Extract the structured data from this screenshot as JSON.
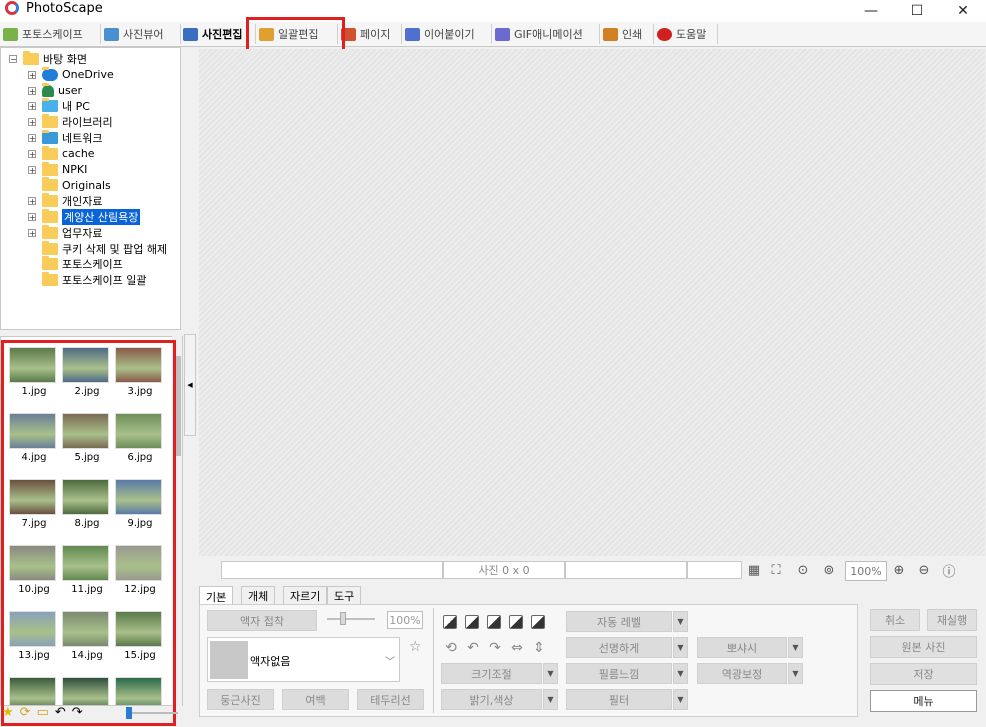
{
  "window": {
    "title": "PhotoScape",
    "minimize": "—",
    "maximize": "☐",
    "close": "✕"
  },
  "tabs": [
    {
      "label": "포토스케이프",
      "color": "#7ab24a"
    },
    {
      "label": "사진뷰어",
      "color": "#4a8fcf"
    },
    {
      "label": "사진편집",
      "color": "#3a6fbf"
    },
    {
      "label": "일괄편집",
      "color": "#e0a030"
    },
    {
      "label": "페이지",
      "color": "#d05030"
    },
    {
      "label": "이어붙이기",
      "color": "#5070d0"
    },
    {
      "label": "GIF애니메이션",
      "color": "#6a6acf"
    },
    {
      "label": "인쇄",
      "color": "#d08020"
    },
    {
      "label": "도움말",
      "color": "#d02020"
    }
  ],
  "tree": [
    {
      "label": "바탕 화면",
      "expand": "−",
      "icon": "folder-icon"
    },
    {
      "label": "OneDrive",
      "expand": "+",
      "icon": "cloud-icon"
    },
    {
      "label": "user",
      "expand": "+",
      "icon": "user-icon"
    },
    {
      "label": "내 PC",
      "expand": "+",
      "icon": "pc-icon"
    },
    {
      "label": "라이브러리",
      "expand": "+",
      "icon": "folder-icon"
    },
    {
      "label": "네트워크",
      "expand": "+",
      "icon": "network-icon"
    },
    {
      "label": "cache",
      "expand": "+",
      "icon": "folder-icon"
    },
    {
      "label": "NPKI",
      "expand": "+",
      "icon": "folder-icon"
    },
    {
      "label": "Originals",
      "expand": "",
      "icon": "folder-icon"
    },
    {
      "label": "개인자료",
      "expand": "+",
      "icon": "folder-icon"
    },
    {
      "label": "계양산 산림욕장",
      "expand": "+",
      "icon": "folder-icon",
      "selected": true
    },
    {
      "label": "업무자료",
      "expand": "+",
      "icon": "folder-icon"
    },
    {
      "label": "쿠키 삭제 및 팝업 해제",
      "expand": "",
      "icon": "folder-icon"
    },
    {
      "label": "포토스케이프",
      "expand": "",
      "icon": "folder-icon"
    },
    {
      "label": "포토스케이프 일괄",
      "expand": "",
      "icon": "folder-icon"
    }
  ],
  "thumbnails": [
    {
      "name": "1.jpg",
      "color": "#5a7a4a"
    },
    {
      "name": "2.jpg",
      "color": "#4f6a86"
    },
    {
      "name": "3.jpg",
      "color": "#8a5a4a"
    },
    {
      "name": "4.jpg",
      "color": "#6a7f98"
    },
    {
      "name": "5.jpg",
      "color": "#7a6a55"
    },
    {
      "name": "6.jpg",
      "color": "#6f8f5a"
    },
    {
      "name": "7.jpg",
      "color": "#6a5040"
    },
    {
      "name": "8.jpg",
      "color": "#4e6a3e"
    },
    {
      "name": "9.jpg",
      "color": "#5a7aa8"
    },
    {
      "name": "10.jpg",
      "color": "#8a8a80"
    },
    {
      "name": "11.jpg",
      "color": "#5f8a50"
    },
    {
      "name": "12.jpg",
      "color": "#9a9a90"
    },
    {
      "name": "13.jpg",
      "color": "#8aa0b8"
    },
    {
      "name": "14.jpg",
      "color": "#7a8a70"
    },
    {
      "name": "15.jpg",
      "color": "#5a7a4a"
    },
    {
      "name": "",
      "color": "#3a5a3a"
    },
    {
      "name": "",
      "color": "#2f4f3f"
    },
    {
      "name": "",
      "color": "#2a6a4a"
    }
  ],
  "status": {
    "photo_count": "사진 0 x 0",
    "zoom": "100%"
  },
  "subtabs": [
    "기본",
    "개체",
    "자르기",
    "도구"
  ],
  "edit": {
    "frame_fit": "액자 접착",
    "percent": "100%",
    "frame_name": "액자없음",
    "round": "둥근사진",
    "margin": "여백",
    "border": "테두리선",
    "auto_level": "자동 레벨",
    "sharpen": "선명하게",
    "film": "필름느낌",
    "filter": "필터",
    "resize": "크기조절",
    "bright": "밝기,색상",
    "bokeh": "뽀샤시",
    "backlight": "역광보정"
  },
  "actions": {
    "undo": "취소",
    "redo": "재실행",
    "original": "원본 사진",
    "save": "저장",
    "menu": "메뉴"
  },
  "colors": {
    "highlight": "#e02020",
    "selection": "#0a64d8",
    "folder": "#f8cc59"
  }
}
